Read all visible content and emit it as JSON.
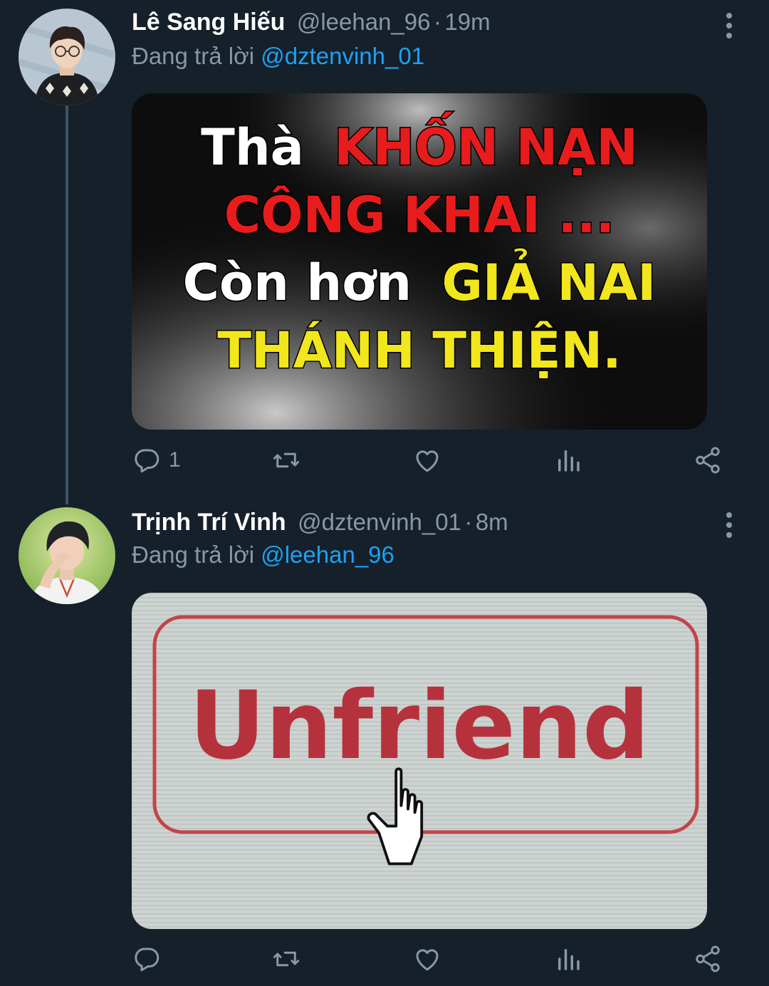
{
  "tweets": [
    {
      "name": "Lê Sang Hiếu",
      "handle": "@leehan_96",
      "separator": "·",
      "time": "19m",
      "reply_prefix": "Đang trả lời",
      "reply_to": "@dztenvinh_01",
      "image_text": {
        "line1_white": "Thà",
        "line1_red": "KHỐN NẠN",
        "line2_red": "CÔNG KHAI ...",
        "line3_white": "Còn hơn",
        "line3_yellow": "GIẢ NAI",
        "line4_yellow": "THÁNH THIỆN."
      },
      "reply_count": "1",
      "icons": [
        "reply-icon",
        "retweet-icon",
        "like-icon",
        "analytics-icon",
        "share-icon",
        "more-icon"
      ]
    },
    {
      "name": "Trịnh Trí Vinh",
      "handle": "@dztenvinh_01",
      "separator": "·",
      "time": "8m",
      "reply_prefix": "Đang trả lời",
      "reply_to": "@leehan_96",
      "image_text": {
        "button_label": "Unfriend"
      },
      "icons": [
        "reply-icon",
        "retweet-icon",
        "like-icon",
        "analytics-icon",
        "share-icon",
        "more-icon"
      ]
    }
  ],
  "colors": {
    "background": "#15202b",
    "text_primary": "#ffffff",
    "text_secondary": "#8899a6",
    "link": "#1da1f2",
    "thread_line": "#3d5466",
    "image_red": "#e81c1c",
    "image_yellow": "#f2e61c",
    "unfriend_red": "#b5323c"
  }
}
